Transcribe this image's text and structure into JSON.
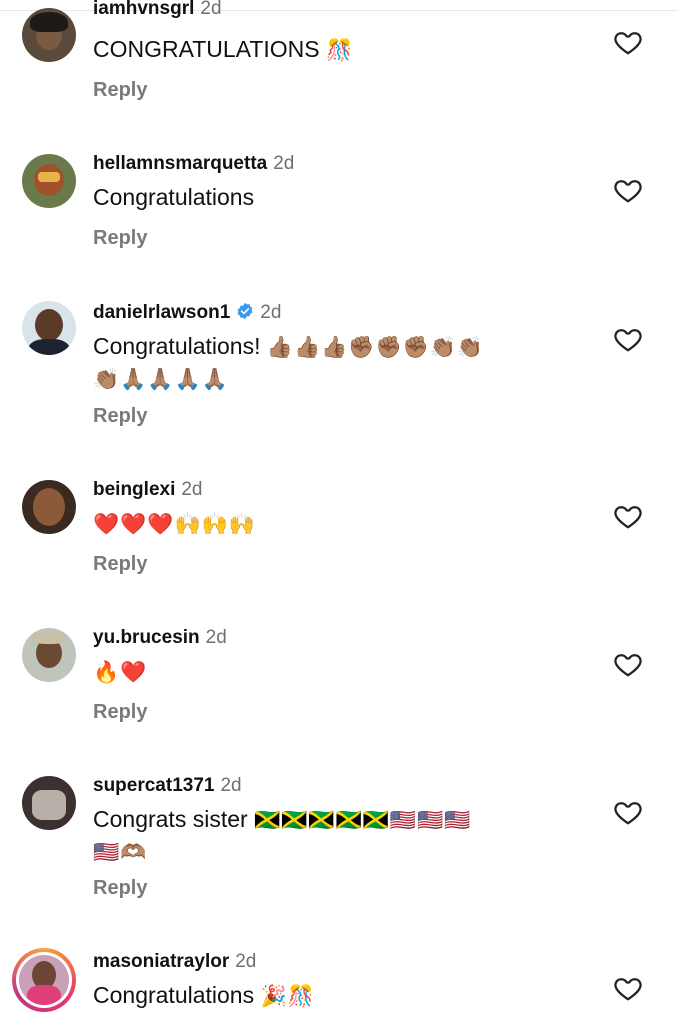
{
  "reply_label": "Reply",
  "colors": {
    "muted": "#6f6f6f",
    "verified": "#3897f0",
    "heart_outline": "#222222"
  },
  "comments": [
    {
      "username": "iamhvnsgrl",
      "time": "2d",
      "text": "CONGRATULATIONS",
      "emoji": "🎊",
      "verified": false
    },
    {
      "username": "hellamnsmarquetta",
      "time": "2d",
      "text": "Congratulations",
      "emoji": "",
      "verified": false
    },
    {
      "username": "danielrlawson1",
      "time": "2d",
      "text": "Congratulations!",
      "emoji": "👍🏽👍🏽👍🏽✊🏽✊🏽✊🏽👏🏽👏🏽",
      "emoji_line2": "👏🏽🙏🏽🙏🏽🙏🏽🙏🏽",
      "verified": true
    },
    {
      "username": "beinglexi",
      "time": "2d",
      "text": "",
      "emoji": "❤️❤️❤️🙌🙌🙌",
      "verified": false
    },
    {
      "username": "yu.brucesin",
      "time": "2d",
      "text": "",
      "emoji": "🔥❤️",
      "verified": false
    },
    {
      "username": "supercat1371",
      "time": "2d",
      "text": "Congrats sister",
      "emoji": "🇯🇲🇯🇲🇯🇲🇯🇲🇯🇲🇺🇸🇺🇸🇺🇸",
      "emoji_line2": "🇺🇸🫶🏽",
      "verified": false
    },
    {
      "username": "masoniatraylor",
      "time": "2d",
      "text": "Congratulations",
      "emoji": "🎉🎊",
      "verified": false
    }
  ]
}
